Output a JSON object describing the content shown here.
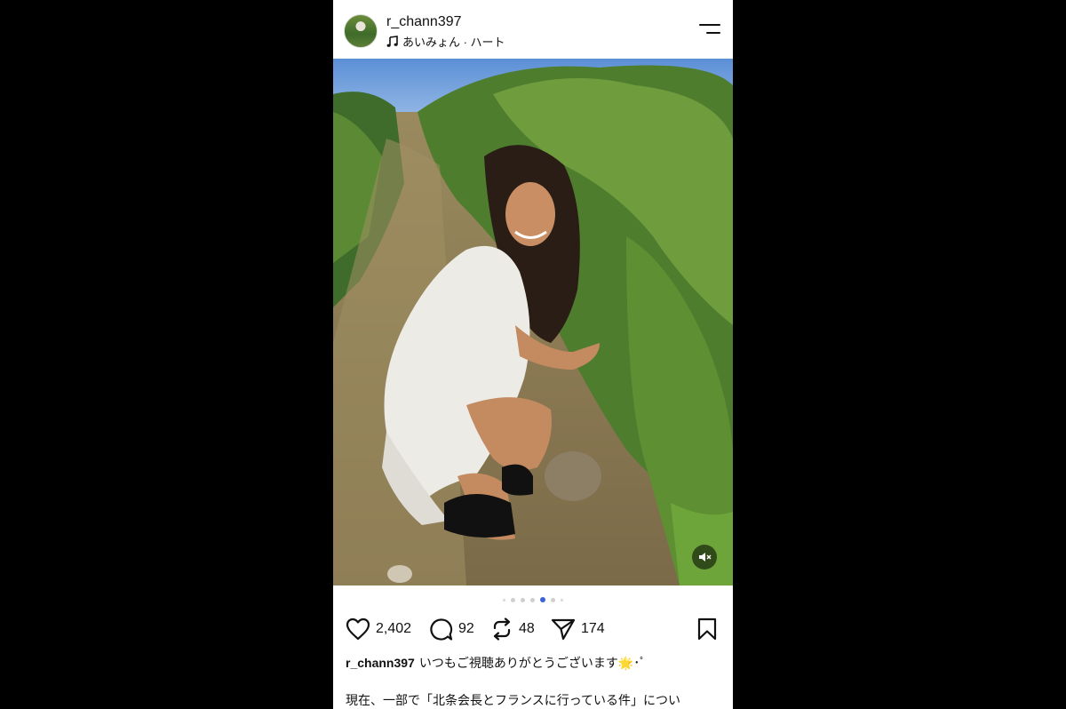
{
  "post": {
    "username": "r_chann397",
    "music": "あいみょん · ハート",
    "photo_dots": {
      "count": 7,
      "active_index": 4
    },
    "actions": {
      "likes": "2,402",
      "comments": "92",
      "reposts": "48",
      "shares": "174"
    },
    "caption": {
      "username": "r_chann397",
      "text": "いつもご視聴ありがとうございます🌟･ﾟ",
      "line2": "現在、一部で「北条会長とフランスに行っている件」につい"
    }
  },
  "icons": {
    "menu": "hamburger-icon",
    "music": "music-note-icon",
    "mute": "speaker-muted-icon",
    "like": "heart-icon",
    "comment": "comment-bubble-icon",
    "repost": "repost-icon",
    "share": "send-icon",
    "save": "bookmark-icon"
  }
}
